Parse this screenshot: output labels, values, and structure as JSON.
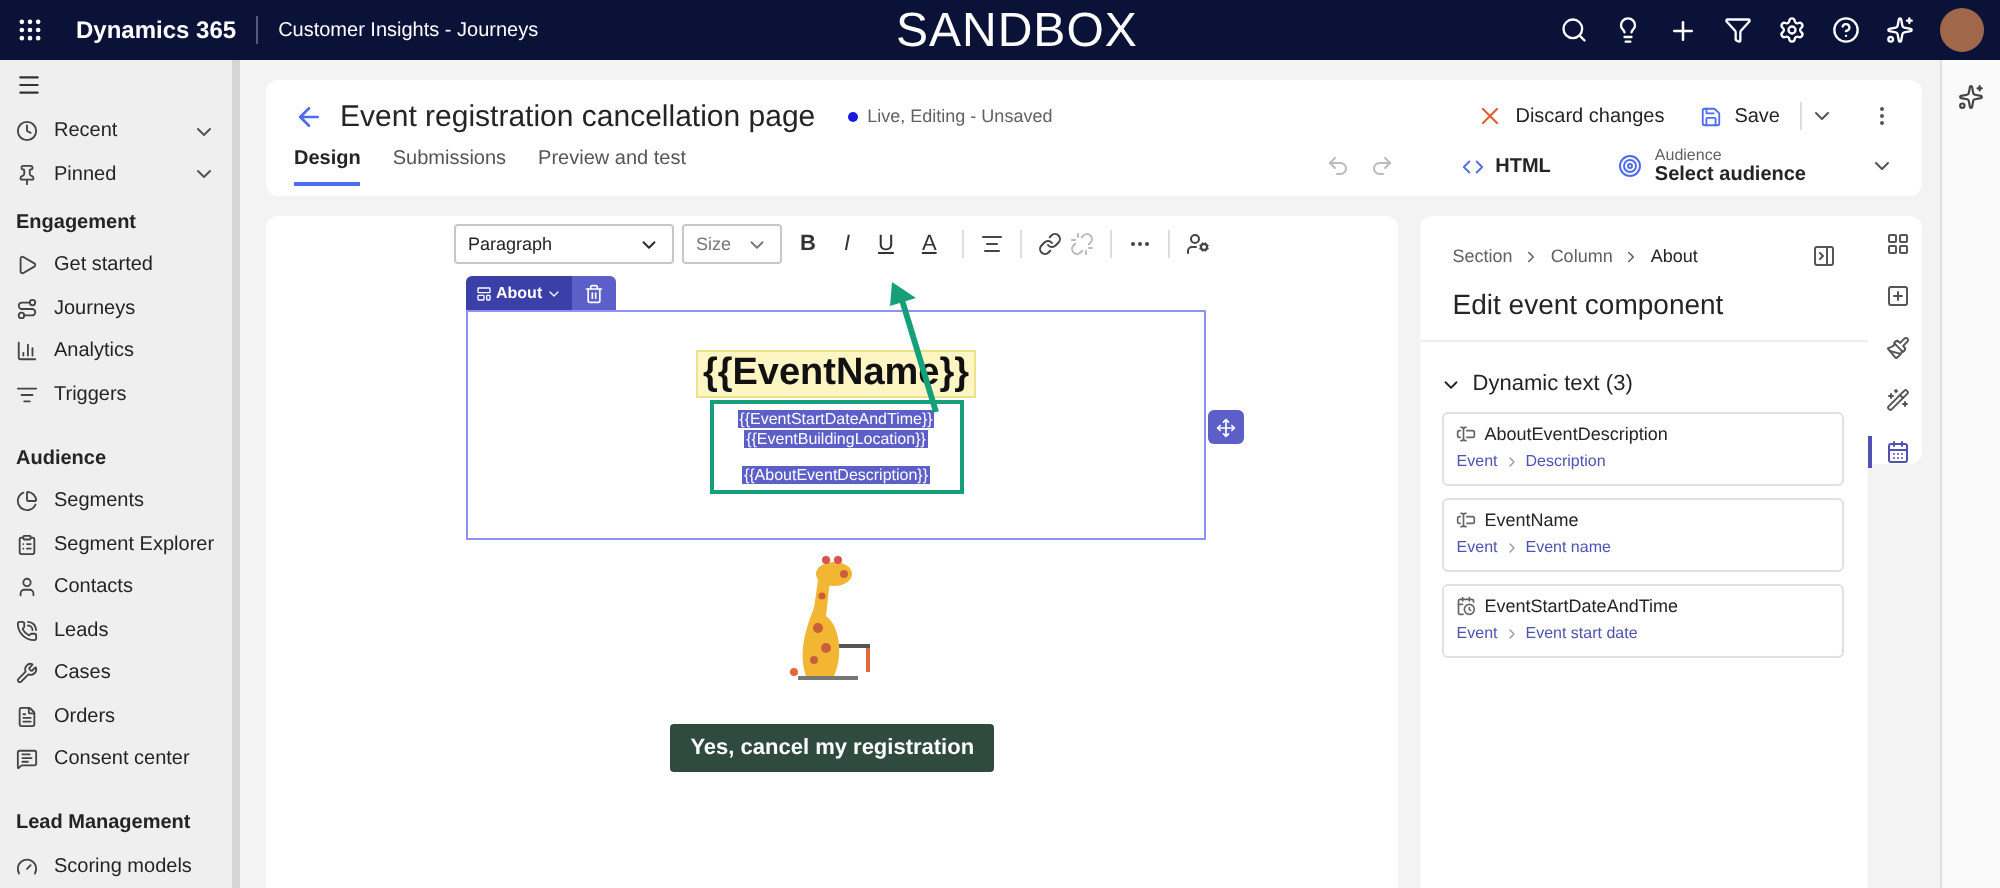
{
  "top_bar": {
    "app_name": "Dynamics 365",
    "area": "Customer Insights - Journeys",
    "environment": "SANDBOX"
  },
  "sidebar": {
    "groups": [
      {
        "items": [
          {
            "label": "Recent",
            "kind": "expandable"
          },
          {
            "label": "Pinned",
            "kind": "expandable"
          }
        ]
      },
      {
        "title": "Engagement",
        "items": [
          {
            "label": "Get started",
            "kind": "link"
          },
          {
            "label": "Journeys",
            "kind": "link"
          },
          {
            "label": "Analytics",
            "kind": "link"
          },
          {
            "label": "Triggers",
            "kind": "link"
          }
        ]
      },
      {
        "title": "Audience",
        "items": [
          {
            "label": "Segments",
            "kind": "link"
          },
          {
            "label": "Segment Explorer",
            "kind": "link"
          },
          {
            "label": "Contacts",
            "kind": "link"
          },
          {
            "label": "Leads",
            "kind": "link"
          },
          {
            "label": "Cases",
            "kind": "link"
          },
          {
            "label": "Orders",
            "kind": "link"
          },
          {
            "label": "Consent center",
            "kind": "link"
          }
        ]
      },
      {
        "title": "Lead Management",
        "items": [
          {
            "label": "Scoring models",
            "kind": "link"
          }
        ]
      }
    ]
  },
  "header": {
    "title": "Event registration cancellation page",
    "status": "Live, Editing - Unsaved",
    "tabs": [
      {
        "label": "Design",
        "selected": true
      },
      {
        "label": "Submissions",
        "selected": false
      },
      {
        "label": "Preview and test",
        "selected": false
      }
    ],
    "discard": "Discard changes",
    "save": "Save",
    "html": "HTML",
    "audience": {
      "label": "Audience",
      "value": "Select audience"
    }
  },
  "editor": {
    "toolbar": {
      "paragraph": "Paragraph",
      "size": "Size",
      "bold": "B",
      "italic": "I",
      "underline": "U",
      "font_color": "A"
    },
    "block_tag": "About",
    "event_name": "{{EventName}}",
    "tokens": [
      "{{EventStartDateAndTime}}",
      "{{EventBuildingLocation}}",
      "{{AboutEventDescription}}"
    ],
    "button": "Yes, cancel my registration"
  },
  "panel": {
    "breadcrumb": [
      "Section",
      "Column",
      "About"
    ],
    "title": "Edit event component",
    "section": {
      "label": "Dynamic text (3)",
      "expanded": true
    },
    "fields": [
      {
        "name": "AboutEventDescription",
        "path": [
          "Event",
          "Description"
        ],
        "kind": "text"
      },
      {
        "name": "EventName",
        "path": [
          "Event",
          "Event name"
        ],
        "kind": "text"
      },
      {
        "name": "EventStartDateAndTime",
        "path": [
          "Event",
          "Event start date"
        ],
        "kind": "date"
      }
    ]
  },
  "rail_tabs": [
    {
      "selected": false
    },
    {
      "selected": false
    },
    {
      "selected": false
    },
    {
      "selected": false
    },
    {
      "selected": true
    }
  ]
}
